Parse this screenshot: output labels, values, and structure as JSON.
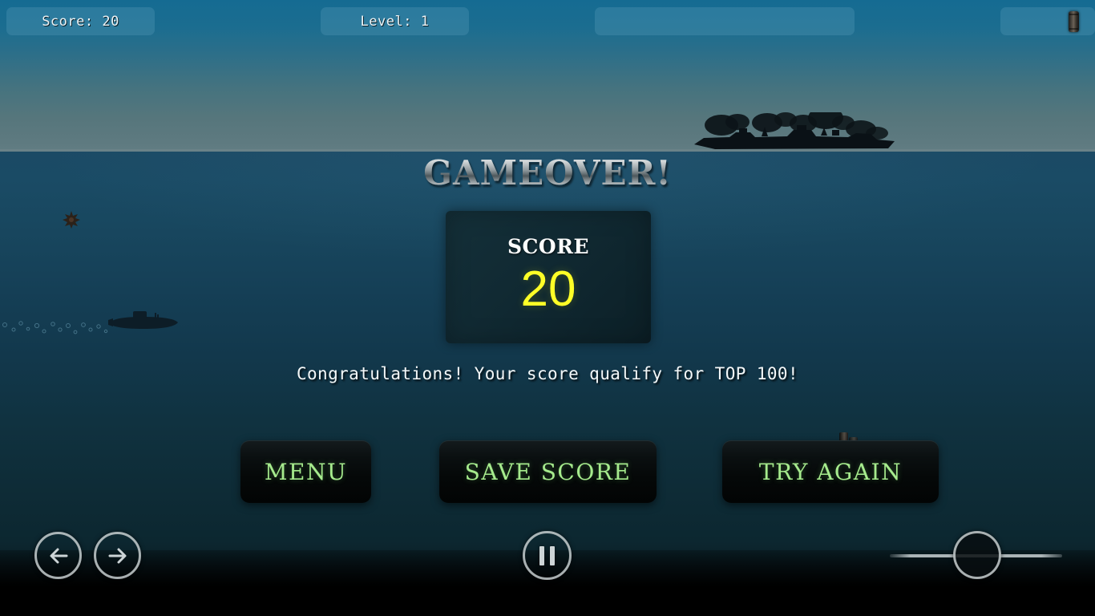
{
  "hud": {
    "score_text": "Score: 20",
    "level_text": "Level: 1",
    "wide_panel_text": "",
    "ammo_icon": "depth-charge-icon"
  },
  "gameover": {
    "title": "GAMEOVER!",
    "score_label": "SCORE",
    "score_value": "20",
    "message": "Congratulations! Your score qualify for TOP 100!"
  },
  "buttons": {
    "menu": "MENU",
    "save_score": "SAVE SCORE",
    "try_again": "TRY AGAIN"
  },
  "controls": {
    "move_left": "arrow-left-icon",
    "move_right": "arrow-right-icon",
    "pause": "pause-icon",
    "slider_label": ""
  },
  "sprites": {
    "warship": "burning-warship-silhouette",
    "submarine": "submarine-silhouette",
    "debris": "explosion-debris",
    "bubbles": "bubble-trail",
    "depth_charges": "falling-depth-charges"
  },
  "colors": {
    "sky_top": "#156b92",
    "sky_horizon": "#627d83",
    "sea_top": "#1b4a65",
    "sea_bottom": "#000000",
    "hud_panel": "rgba(92,160,188,0.30)",
    "score_value": "#ffff27",
    "button_label": "#a6eb8d",
    "control_stroke": "#cdd4d6"
  }
}
